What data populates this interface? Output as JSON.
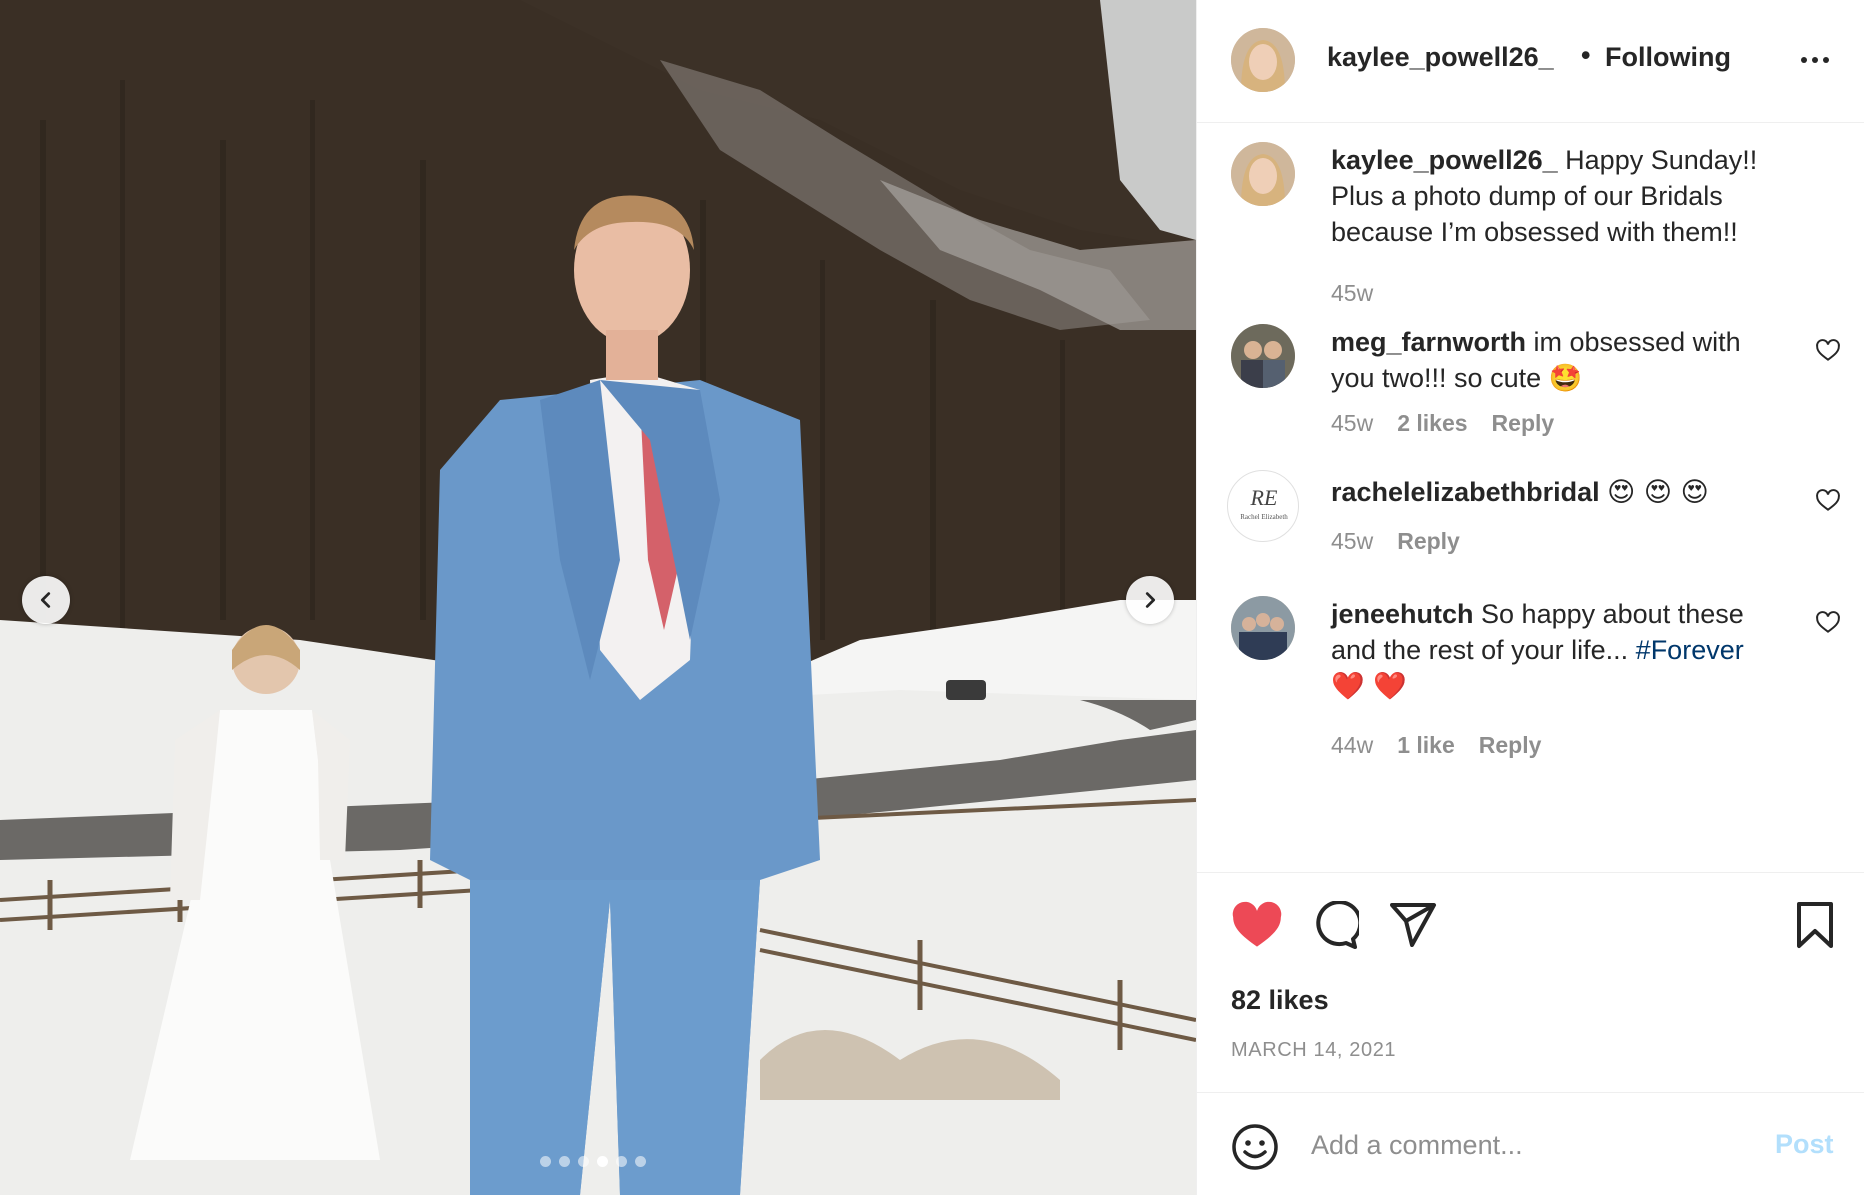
{
  "post": {
    "username": "kaylee_powell26_",
    "separator": "•",
    "follow_state": "Following",
    "more_label": "More options"
  },
  "carousel": {
    "total_slides": 6,
    "active_index": 3,
    "prev_label": "Previous",
    "next_label": "Next"
  },
  "caption": {
    "username": "kaylee_powell26_",
    "text": " Happy Sunday!! Plus a photo dump of our Bridals because I’m obsessed with them!!",
    "time": "45w"
  },
  "comments": [
    {
      "username": "meg_farnworth",
      "text": " im obsessed with you two!!! so cute ",
      "emoji": "🤩",
      "time": "45w",
      "likes": "2 likes",
      "reply": "Reply"
    },
    {
      "username": "rachelelizabethbridal",
      "text": " ",
      "emoji": "😍 😍 😍",
      "time": "45w",
      "reply": "Reply",
      "avatar_logo_text": "RE",
      "avatar_logo_sub": "Rachel Elizabeth"
    },
    {
      "username": "jeneehutch",
      "text": " So happy about these and the rest of your life... ",
      "hashtag": "#Forever",
      "emoji": "❤️ ❤️",
      "time": "44w",
      "likes": "1 like",
      "reply": "Reply"
    }
  ],
  "actions": {
    "liked": true,
    "like_color": "#ed4956",
    "likes_text": "82 likes",
    "date": "MARCH 14, 2021"
  },
  "comment_box": {
    "placeholder": "Add a comment...",
    "post_label": "Post",
    "post_color": "#b2dffc"
  }
}
